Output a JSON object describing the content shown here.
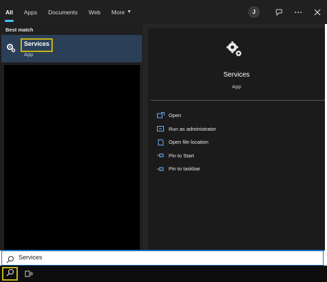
{
  "tabs": [
    {
      "label": "All",
      "active": true
    },
    {
      "label": "Apps"
    },
    {
      "label": "Documents"
    },
    {
      "label": "Web"
    },
    {
      "label": "More"
    }
  ],
  "top_actions": {
    "avatar_initial": "J",
    "feedback_icon": "feedback-icon",
    "more_icon": "ellipsis-icon",
    "close_icon": "close-icon"
  },
  "left": {
    "section_label": "Best match",
    "best_match": {
      "title": "Services",
      "subtitle": "App",
      "icon": "services-gear-icon"
    }
  },
  "detail": {
    "title": "Services",
    "subtitle": "App",
    "actions": [
      {
        "label": "Open",
        "icon": "open-icon"
      },
      {
        "label": "Run as administrator",
        "icon": "shield-icon"
      },
      {
        "label": "Open file location",
        "icon": "folder-icon"
      },
      {
        "label": "Pin to Start",
        "icon": "pin-icon"
      },
      {
        "label": "Pin to taskbar",
        "icon": "pin-icon"
      }
    ]
  },
  "search": {
    "value": "Services"
  },
  "colors": {
    "accent": "#4cc2ff",
    "highlight": "#c8b419",
    "selected": "#2b4057",
    "search_border": "#1a73c6"
  }
}
